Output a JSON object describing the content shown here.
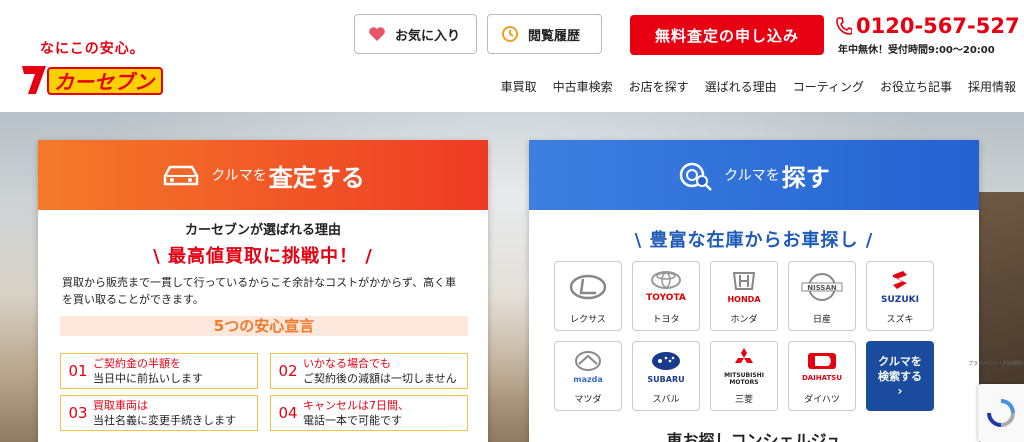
{
  "header": {
    "tagline": "なにこの安心。",
    "logo_text": "7カーセブン",
    "favorites_label": "お気に入り",
    "history_label": "閲覧履歴",
    "apply_label": "無料査定の申し込み",
    "phone": "0120-567-527",
    "phone_hours": "年中無休！受付時間9:00〜20:00",
    "nav": [
      "車買取",
      "中古車検索",
      "お店を探す",
      "選ばれる理由",
      "コーティング",
      "お役立ち記事",
      "採用情報"
    ]
  },
  "sell_card": {
    "header_small": "クルマを",
    "header_big": "査定する",
    "reason": "カーセブンが選ばれる理由",
    "catch": "最高値買取に挑戦中！",
    "description": "買取から販売まで一貫して行っているからこそ余計なコストがかからず、高く車を買い取ることができます。",
    "declaration_title": "5つの安心宣言",
    "promises": [
      {
        "num": "01",
        "line1": "ご契約金の半額を",
        "line2": "当日中に前払いします"
      },
      {
        "num": "02",
        "line1": "いかなる場合でも",
        "line2": "ご契約後の減額は一切しません"
      },
      {
        "num": "03",
        "line1": "買取車両は",
        "line2": "当社名義に変更手続きします"
      },
      {
        "num": "04",
        "line1": "キャンセルは7日間、",
        "line2": "電話一本で可能です"
      }
    ]
  },
  "search_card": {
    "header_small": "クルマを",
    "header_big": "探す",
    "stock_title": "豊富な在庫からお車探し",
    "makers": [
      {
        "logo": "LEXUS-logo",
        "label": "レクサス"
      },
      {
        "logo": "TOYOTA",
        "label": "トヨタ"
      },
      {
        "logo": "HONDA",
        "label": "ホンダ"
      },
      {
        "logo": "NISSAN",
        "label": "日産"
      },
      {
        "logo": "SUZUKI",
        "label": "スズキ"
      },
      {
        "logo": "mazda",
        "label": "マツダ"
      },
      {
        "logo": "SUBARU",
        "label": "スバル"
      },
      {
        "logo": "MITSUBISHI MOTORS",
        "label": "三菱"
      },
      {
        "logo": "DAIHATSU",
        "label": "ダイハツ"
      }
    ],
    "search_button_line1": "クルマを",
    "search_button_line2": "検索する",
    "concierge": "車お探しコンシェルジュ"
  },
  "colors": {
    "brand_red": "#e60012",
    "sell_gradient_start": "#f47a2a",
    "sell_gradient_end": "#ee3b24",
    "search_blue": "#2462d0",
    "search_button": "#1a4b9c",
    "accent_orange": "#f07a2a"
  },
  "recaptcha_label": "プライバシー・利用規約"
}
